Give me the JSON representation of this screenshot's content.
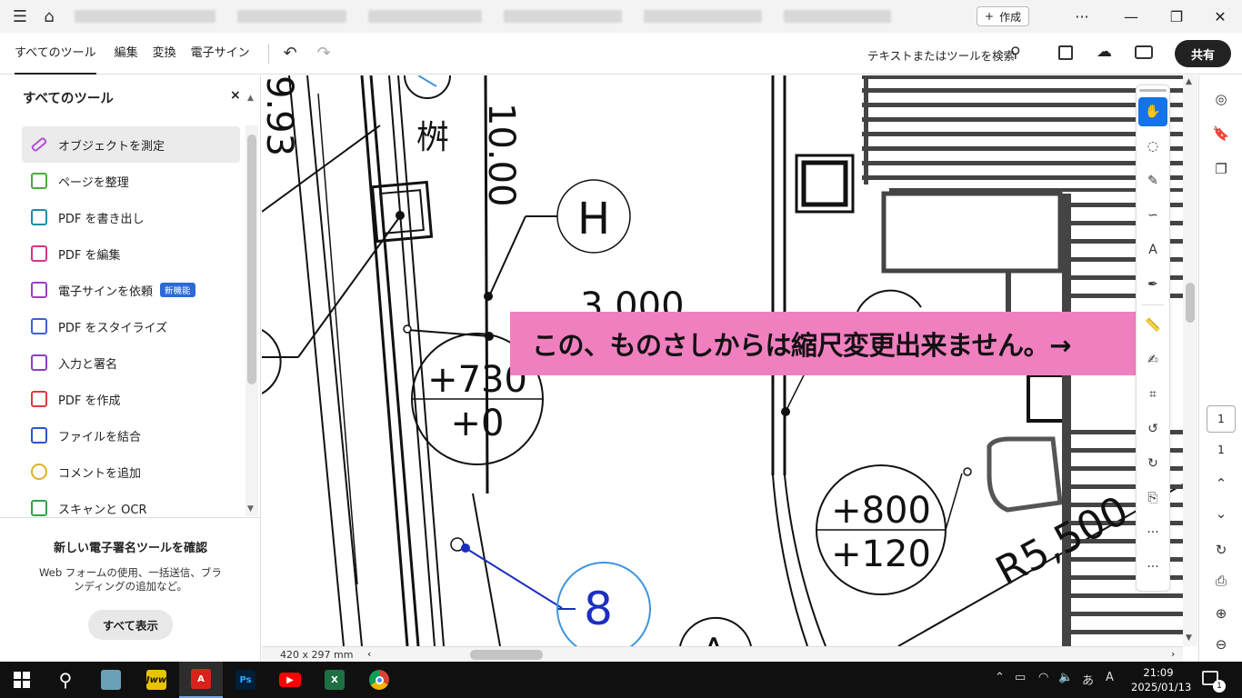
{
  "titlebar": {
    "create_label": "作成",
    "more": "···"
  },
  "menubar": {
    "items": [
      "すべてのツール",
      "編集",
      "変換",
      "電子サイン"
    ],
    "search_label": "テキストまたはツールを検索",
    "share_label": "共有"
  },
  "sidebar": {
    "title": "すべてのツール",
    "close": "×",
    "tools": [
      {
        "label": "オブジェクトを測定",
        "icon": "measure-icon",
        "color": "#b24fd9"
      },
      {
        "label": "ページを整理",
        "icon": "organize-pages-icon",
        "color": "#4caa3e"
      },
      {
        "label": "PDF を書き出し",
        "icon": "export-pdf-icon",
        "color": "#1b8fa6"
      },
      {
        "label": "PDF を編集",
        "icon": "edit-pdf-icon",
        "color": "#d6338a"
      },
      {
        "label": "電子サインを依頼",
        "icon": "request-esign-icon",
        "color": "#9b3fc7",
        "badge": "新機能"
      },
      {
        "label": "PDF をスタイライズ",
        "icon": "stylize-icon",
        "color": "#3d5fd6"
      },
      {
        "label": "入力と署名",
        "icon": "fill-sign-icon",
        "color": "#8a3fc7"
      },
      {
        "label": "PDF を作成",
        "icon": "create-pdf-icon",
        "color": "#e03b3b"
      },
      {
        "label": "ファイルを結合",
        "icon": "combine-icon",
        "color": "#2a56c6"
      },
      {
        "label": "コメントを追加",
        "icon": "comment-icon",
        "color": "#e0b020"
      },
      {
        "label": "スキャンと OCR",
        "icon": "scan-ocr-icon",
        "color": "#2ea34a"
      }
    ],
    "promo": {
      "title": "新しい電子署名ツールを確認",
      "body": "Web フォームの使用、一括送信、ブランディングの追加など。",
      "button": "すべて表示"
    }
  },
  "drawing": {
    "labels": {
      "h_marker": "H",
      "a_marker": "A",
      "dim_3000": "3,000",
      "dim_1000": "10.00",
      "dim_993": "9.93",
      "kanji": "桝",
      "elev1_top": "+730",
      "elev1_bottom": "+0",
      "elev2_top": "+800",
      "elev2_bottom": "+120",
      "radius": "R5,500",
      "marker_8": "8"
    }
  },
  "annotation": {
    "text": "この、ものさしからは縮尺変更出来ません。→",
    "bg_color": "#f07fc0"
  },
  "page_nav": {
    "current": "1",
    "total": "1"
  },
  "status": {
    "dimensions": "420 x 297 mm"
  },
  "taskbar": {
    "time": "21:09",
    "date": "2025/01/13",
    "notifications": "1"
  }
}
